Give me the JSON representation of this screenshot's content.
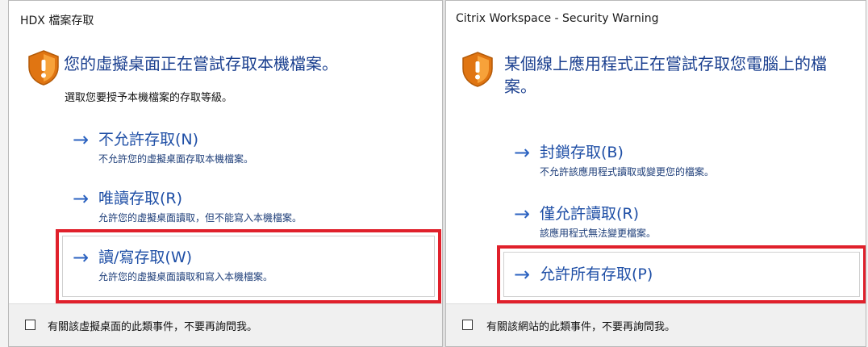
{
  "left_dialog": {
    "title": "HDX 檔案存取",
    "headline": "您的虛擬桌面正在嘗試存取本機檔案。",
    "subhead": "選取您要授予本機檔案的存取等級。",
    "options": [
      {
        "arrow": "→",
        "label": "不允許存取(N)",
        "desc": "不允許您的虛擬桌面存取本機檔案。"
      },
      {
        "arrow": "→",
        "label": "唯讀存取(R)",
        "desc": "允許您的虛擬桌面讀取，但不能寫入本機檔案。"
      },
      {
        "arrow": "→",
        "label": "讀/寫存取(W)",
        "desc": "允許您的虛擬桌面讀取和寫入本機檔案。"
      }
    ],
    "footer_checkbox_label": "有關該虛擬桌面的此類事件，不要再詢問我。"
  },
  "right_dialog": {
    "title": "Citrix Workspace - Security Warning",
    "headline_line1": "某個線上應用程式正在嘗試存取您電腦上的檔",
    "headline_line2": "案。",
    "options": [
      {
        "arrow": "→",
        "label": "封鎖存取(B)",
        "desc": "不允許該應用程式讀取或變更您的檔案。"
      },
      {
        "arrow": "→",
        "label": "僅允許讀取(R)",
        "desc": "該應用程式無法變更檔案。"
      },
      {
        "arrow": "→",
        "label": "允許所有存取(P)"
      }
    ],
    "footer_checkbox_label": "有關該網站的此類事件，不要再詢問我。"
  },
  "colors": {
    "highlight": "#e0202b",
    "link_blue": "#1f4fa6",
    "headline_blue": "#1a3f8f",
    "shield_orange": "#f08a1c"
  },
  "icons": {
    "shield": "shield-warning-icon",
    "arrow": "arrow-right-icon",
    "checkbox": "checkbox-unchecked"
  }
}
